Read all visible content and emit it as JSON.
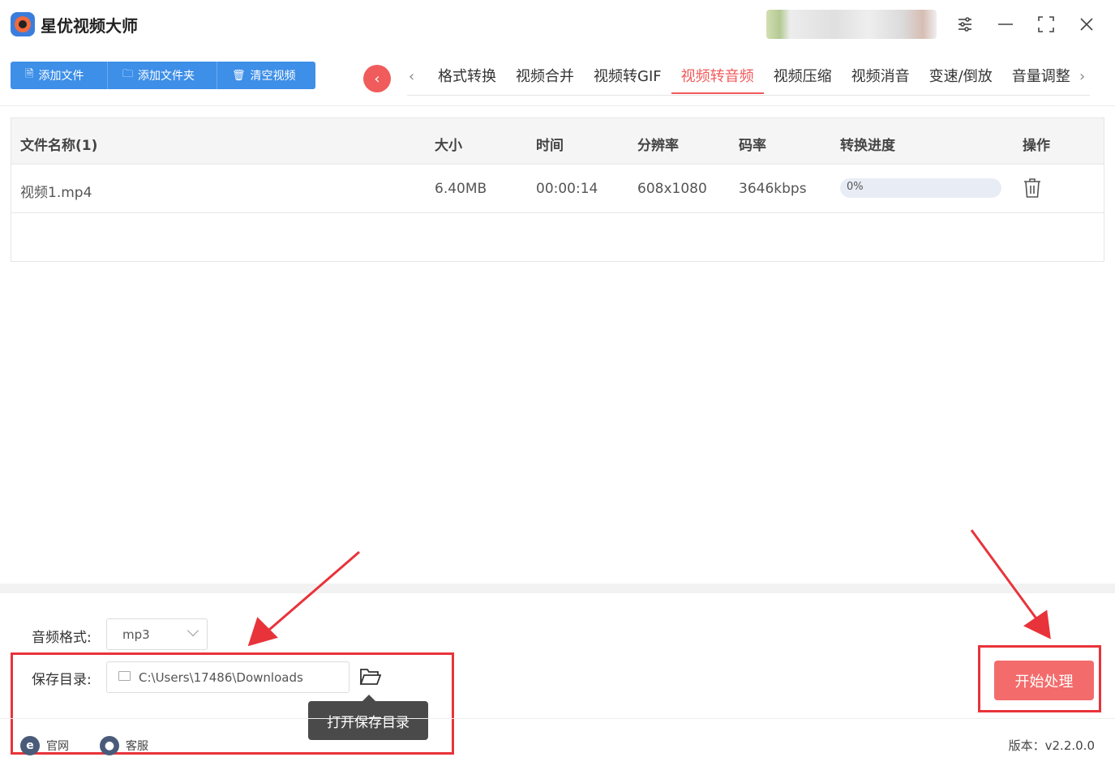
{
  "app": {
    "title": "星优视频大师"
  },
  "toolbar": {
    "add_file": "添加文件",
    "add_folder": "添加文件夹",
    "clear": "清空视频"
  },
  "tabs": [
    {
      "label": "格式转换",
      "active": false
    },
    {
      "label": "视频合并",
      "active": false
    },
    {
      "label": "视频转GIF",
      "active": false
    },
    {
      "label": "视频转音频",
      "active": true
    },
    {
      "label": "视频压缩",
      "active": false
    },
    {
      "label": "视频消音",
      "active": false
    },
    {
      "label": "变速/倒放",
      "active": false
    },
    {
      "label": "音量调整",
      "active": false
    }
  ],
  "table": {
    "headers": {
      "name": "文件名称(1)",
      "size": "大小",
      "duration": "时间",
      "resolution": "分辨率",
      "bitrate": "码率",
      "progress": "转换进度",
      "action": "操作"
    },
    "rows": [
      {
        "name": "视频1.mp4",
        "size": "6.40MB",
        "duration": "00:00:14",
        "resolution": "608x1080",
        "bitrate": "3646kbps",
        "progress": "0%"
      }
    ]
  },
  "settings": {
    "audio_format_label": "音频格式:",
    "audio_format_value": "mp3",
    "save_dir_label": "保存目录:",
    "save_dir_value": "C:\\Users\\17486\\Downloads",
    "open_dir_tooltip": "打开保存目录"
  },
  "actions": {
    "start": "开始处理"
  },
  "footer": {
    "website": "官网",
    "support": "客服",
    "version": "版本：v2.2.0.0"
  },
  "colors": {
    "accent": "#f05b5b",
    "primary": "#3d8fe8",
    "highlight": "#e8333a"
  }
}
